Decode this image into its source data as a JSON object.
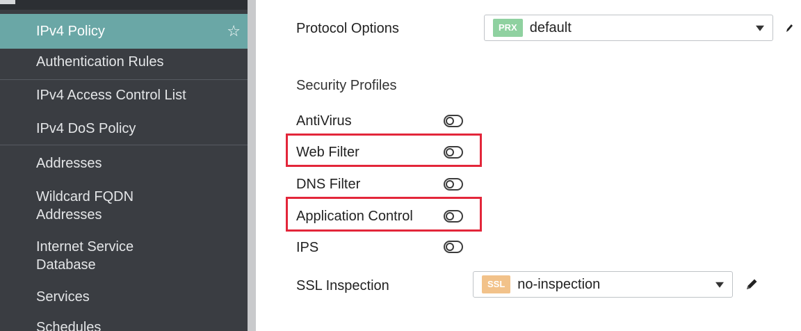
{
  "sidebar": {
    "items": [
      {
        "label": "IPv4 Policy",
        "active": true
      },
      {
        "label": "Authentication Rules"
      },
      {
        "label": "IPv4 Access Control List"
      },
      {
        "label": "IPv4 DoS Policy"
      },
      {
        "label": "Addresses"
      },
      {
        "label_line1": "Wildcard FQDN",
        "label_line2": "Addresses"
      },
      {
        "label_line1": "Internet Service",
        "label_line2": "Database"
      },
      {
        "label": "Services"
      },
      {
        "label": "Schedules"
      }
    ],
    "favorite_icon": "star-outline-icon"
  },
  "protocol_options": {
    "label": "Protocol Options",
    "tag": "PRX",
    "tag_color": "#8fd1a0",
    "value": "default"
  },
  "security_profiles": {
    "title": "Security Profiles",
    "items": [
      {
        "label": "AntiVirus",
        "enabled": false,
        "highlighted": false
      },
      {
        "label": "Web Filter",
        "enabled": false,
        "highlighted": true
      },
      {
        "label": "DNS Filter",
        "enabled": false,
        "highlighted": false
      },
      {
        "label": "Application Control",
        "enabled": false,
        "highlighted": true
      },
      {
        "label": "IPS",
        "enabled": false,
        "highlighted": false
      }
    ]
  },
  "ssl_inspection": {
    "label": "SSL Inspection",
    "tag": "SSL",
    "tag_color": "#f2c28a",
    "value": "no-inspection"
  },
  "colors": {
    "sidebar_bg": "#3a3d42",
    "active_item_bg": "#6aa7a6",
    "highlight_border": "#e3263a"
  },
  "icons": {
    "edit": "pencil-icon",
    "dropdown": "caret-down-icon",
    "toggle": "toggle-off-icon"
  }
}
